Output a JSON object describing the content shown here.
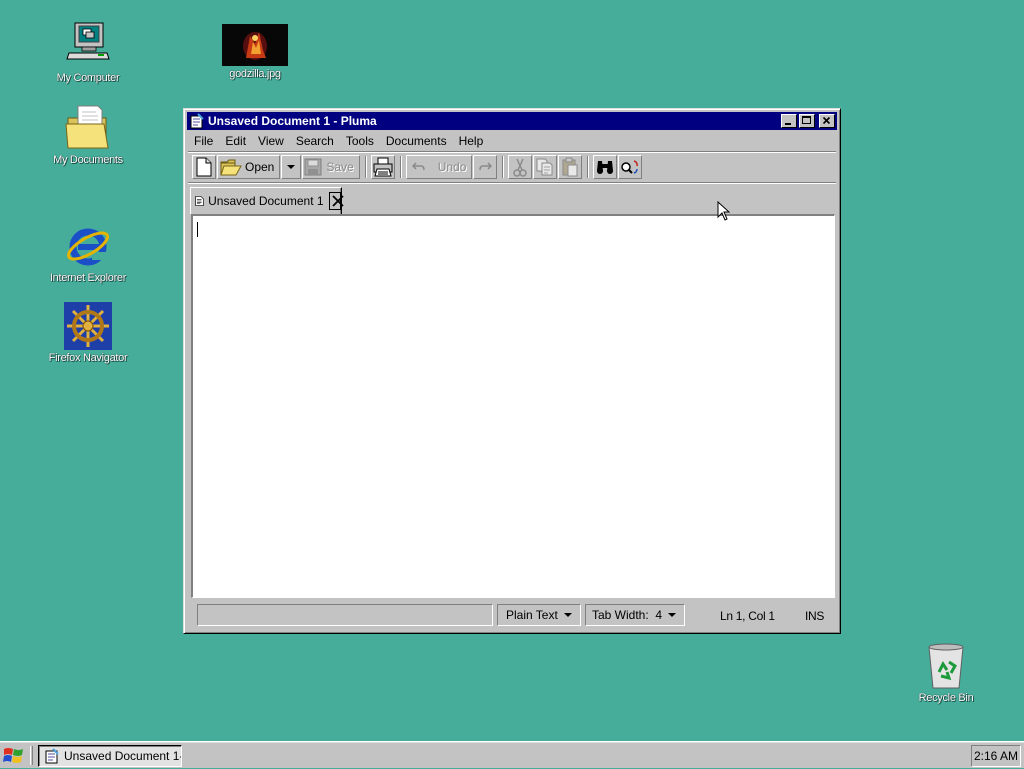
{
  "desktop": {
    "icons": [
      {
        "label": "My Computer"
      },
      {
        "label": "godzilla.jpg"
      },
      {
        "label": "My Documents"
      },
      {
        "label": "Internet Explorer"
      },
      {
        "label": "Firefox Navigator"
      },
      {
        "label": "Recycle Bin"
      }
    ]
  },
  "window": {
    "title": "Unsaved Document 1 - Pluma",
    "menu": [
      "File",
      "Edit",
      "View",
      "Search",
      "Tools",
      "Documents",
      "Help"
    ],
    "toolbar": {
      "open_label": "Open",
      "save_label": "Save",
      "undo_label": "Undo"
    },
    "tab": {
      "label": "Unsaved Document 1"
    },
    "editor": {
      "content": ""
    },
    "status": {
      "language": "Plain Text",
      "tab_width": "Tab Width:  4",
      "position": "Ln 1, Col 1",
      "mode": "INS"
    }
  },
  "taskbar": {
    "task_label": "Unsaved Document 1-...",
    "clock": "2:16 AM"
  },
  "colors": {
    "desktop": "#45ad9a",
    "titlebar_active": "#000080",
    "face": "#c3c3c3"
  }
}
